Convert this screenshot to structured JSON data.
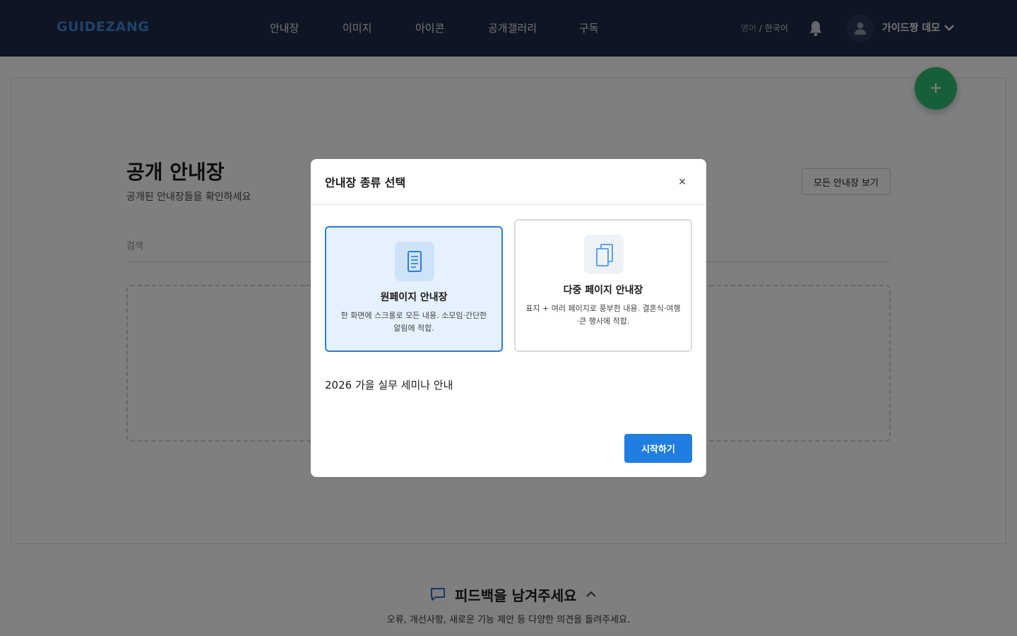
{
  "header": {
    "logo": "GUIDEZANG",
    "nav": [
      "안내장",
      "이미지",
      "아이콘",
      "공개갤러리",
      "구독"
    ],
    "lang_inactive": "영어",
    "lang_sep": " / ",
    "lang_active": "한국어",
    "username": "가이드짱 데모"
  },
  "page": {
    "title": "공개 안내장",
    "subtitle": "공개된 안내장들을 확인하세요",
    "view_all_label": "모든 안내장 보기",
    "search_label": "검색",
    "fab_label": "+"
  },
  "feedback": {
    "title": "피드백을 남겨주세요",
    "description": "오류, 개선사항, 새로운 기능 제안 등 다양한 의견을 들려주세요."
  },
  "modal": {
    "title": "안내장 종류 선택",
    "close_label": "×",
    "options": [
      {
        "title": "원페이지 안내장",
        "description": "한 화면에 스크롤로 모든 내용. 소모임·간단한 알림에 적합.",
        "selected": true,
        "icon": "single-page-icon"
      },
      {
        "title": "다중 페이지 안내장",
        "description": "표지 + 여러 페이지로 풍부한 내용. 결혼식·여행·큰 행사에 적합.",
        "selected": false,
        "icon": "multi-page-icon"
      }
    ],
    "name_value": "2026 가을 실무 세미나 안내",
    "start_label": "시작하기"
  },
  "colors": {
    "topbar": "#1f2a44",
    "logo": "#3b86d8",
    "accent": "#1f7ee0",
    "fab": "#2fbf71",
    "feedback_icon": "#2b6fd1"
  }
}
